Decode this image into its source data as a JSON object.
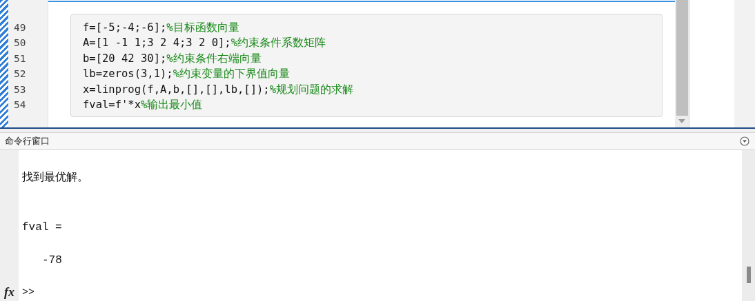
{
  "editor": {
    "lines": [
      {
        "number": "49",
        "code": "f=[-5;-4;-6];",
        "comment": "%目标函数向量"
      },
      {
        "number": "50",
        "code": "A=[1 -1 1;3 2 4;3 2 0];",
        "comment": "%约束条件系数矩阵"
      },
      {
        "number": "51",
        "code": "b=[20 42 30];",
        "comment": "%约束条件右端向量"
      },
      {
        "number": "52",
        "code": "lb=zeros(3,1);",
        "comment": "%约束变量的下界值向量"
      },
      {
        "number": "53",
        "code": "x=linprog(f,A,b,[],[],lb,[]);",
        "comment": "%规划问题的求解"
      },
      {
        "number": "54",
        "code": "fval=f'*x",
        "comment": "%输出最小值"
      }
    ]
  },
  "command_window": {
    "title": "命令行窗口",
    "output": [
      {
        "kind": "message",
        "text": "找到最优解。"
      },
      {
        "kind": "label",
        "text": "fval ="
      },
      {
        "kind": "value",
        "text": "-78"
      }
    ],
    "function_button": "fx",
    "prompt": ">>"
  }
}
